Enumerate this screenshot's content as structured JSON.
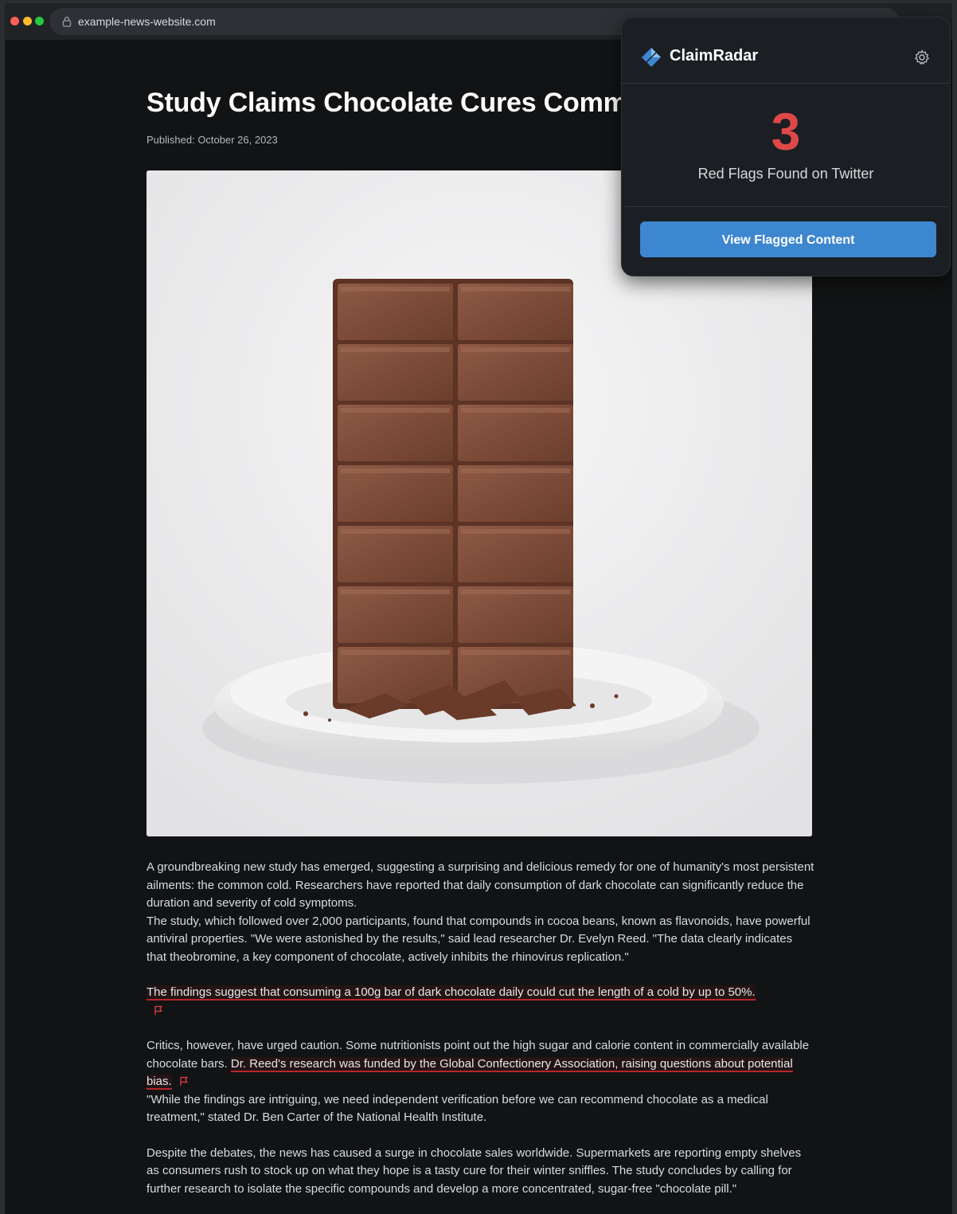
{
  "browser": {
    "url": "example-news-website.com"
  },
  "article": {
    "headline": "Study Claims Chocolate Cures Common Cold",
    "published": "Published: October 26, 2023",
    "image_alt": "Bar of chocolate standing upright on a white plate",
    "p1": "A groundbreaking new study has emerged, suggesting a surprising and delicious remedy for one of humanity's most persistent ailments: the common cold. Researchers have reported that daily consumption of dark chocolate can significantly reduce the duration and severity of cold symptoms.",
    "p2": "The study, which followed over 2,000 participants, found that compounds in cocoa beans, known as flavonoids, have powerful antiviral properties. \"We were astonished by the results,\" said lead researcher Dr. Evelyn Reed. \"The data clearly indicates that theobromine, a key component of chocolate, actively inhibits the rhinovirus replication.\"",
    "flagged_claim_1": "The findings suggest that consuming a 100g bar of dark chocolate daily could cut the length of a cold by up to 50%.",
    "p3_lead": "Critics, however, have urged caution. Some nutritionists point out the high sugar and calorie content in commercially available chocolate bars. ",
    "flagged_claim_2": "Dr. Reed's research was funded by the Global Confectionery Association, raising questions about potential bias.",
    "p4": "\"While the findings are intriguing, we need independent verification before we can recommend chocolate as a medical treatment,\" stated Dr. Ben Carter of the National Health Institute.",
    "p5": "Despite the debates, the news has caused a surge in chocolate sales worldwide. Supermarkets are reporting empty shelves as consumers rush to stock up on what they hope is a tasty cure for their winter sniffles. The study concludes by calling for further research to isolate the specific compounds and develop a more concentrated, sugar-free \"chocolate pill.\""
  },
  "extension": {
    "name": "ClaimRadar",
    "red_flag_count": "3",
    "red_flag_label": "Red Flags Found on Twitter",
    "view_button": "View Flagged Content",
    "icons": [
      "logo-icon",
      "gear-icon",
      "flag-icon",
      "lock-icon"
    ]
  },
  "colors": {
    "accent_blue": "#3d86d0",
    "flag_red": "#e04848",
    "underline_red": "#b8252b"
  }
}
